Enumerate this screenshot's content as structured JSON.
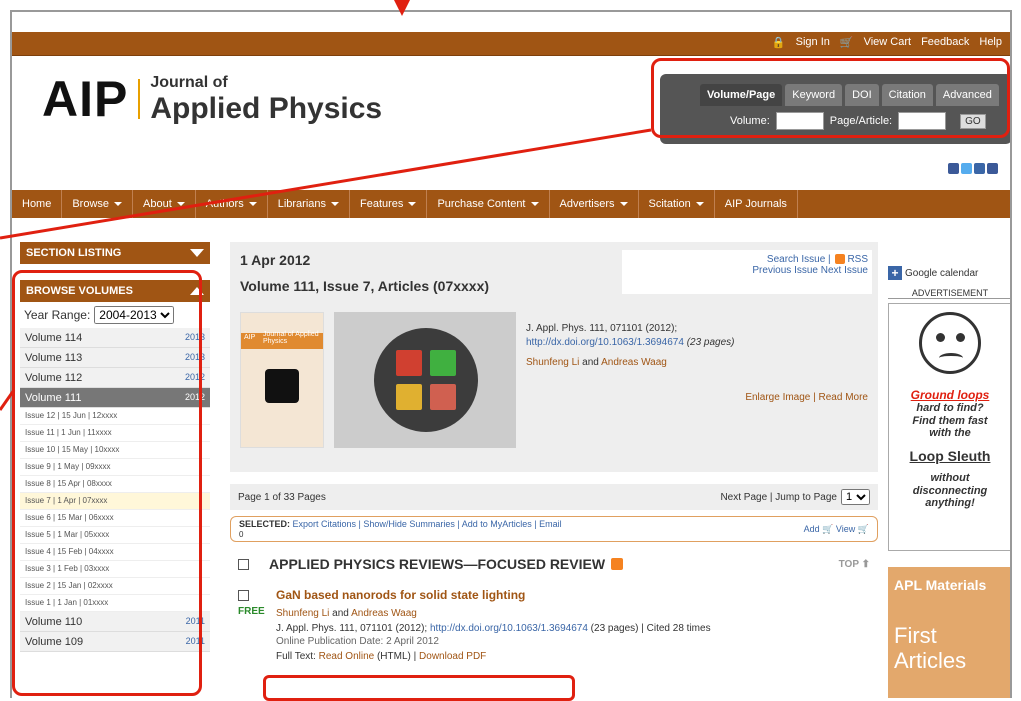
{
  "toplinks": {
    "signin": "Sign In",
    "cart": "View Cart",
    "feedback": "Feedback",
    "help": "Help"
  },
  "logo": {
    "aip": "AIP",
    "journal_of": "Journal of",
    "applied_physics": "Applied Physics"
  },
  "search": {
    "tabs": [
      "Volume/Page",
      "Keyword",
      "DOI",
      "Citation",
      "Advanced"
    ],
    "volume_label": "Volume:",
    "page_label": "Page/Article:",
    "go": "GO"
  },
  "nav": [
    {
      "label": "Home",
      "caret": false
    },
    {
      "label": "Browse",
      "caret": true
    },
    {
      "label": "About",
      "caret": true
    },
    {
      "label": "Authors",
      "caret": true
    },
    {
      "label": "Librarians",
      "caret": true
    },
    {
      "label": "Features",
      "caret": true
    },
    {
      "label": "Purchase Content",
      "caret": true
    },
    {
      "label": "Advertisers",
      "caret": true
    },
    {
      "label": "Scitation",
      "caret": true
    },
    {
      "label": "AIP Journals",
      "caret": false
    }
  ],
  "sidebar": {
    "section_listing": "SECTION LISTING",
    "browse_volumes": "BROWSE VOLUMES",
    "year_range_label": "Year Range:",
    "year_range_value": "2004-2013",
    "volumes_top": [
      {
        "name": "Volume 114",
        "year": "2013"
      },
      {
        "name": "Volume 113",
        "year": "2013"
      },
      {
        "name": "Volume 112",
        "year": "2012"
      },
      {
        "name": "Volume 111",
        "year": "2012"
      }
    ],
    "issues": [
      "Issue 12 | 15 Jun | 12xxxx",
      "Issue 11 | 1 Jun | 11xxxx",
      "Issue 10 | 15 May | 10xxxx",
      "Issue 9 | 1 May | 09xxxx",
      "Issue 8 | 15 Apr | 08xxxx",
      "Issue 7 | 1 Apr | 07xxxx",
      "Issue 6 | 15 Mar | 06xxxx",
      "Issue 5 | 1 Mar | 05xxxx",
      "Issue 4 | 15 Feb | 04xxxx",
      "Issue 3 | 1 Feb | 03xxxx",
      "Issue 2 | 15 Jan | 02xxxx",
      "Issue 1 | 1 Jan | 01xxxx"
    ],
    "volumes_bottom": [
      {
        "name": "Volume 110",
        "year": "2011"
      },
      {
        "name": "Volume 109",
        "year": "2011"
      }
    ]
  },
  "issue": {
    "date": "1 Apr 2012",
    "title": "Volume 111, Issue 7, Articles (07xxxx)",
    "search_issue": "Search Issue | ",
    "rss": "RSS",
    "prev_next": "Previous Issue Next Issue",
    "cover_title": "Journal of Applied Physics",
    "cover_logo": "AIP",
    "citation": "J. Appl. Phys. 111, 071101 (2012);",
    "doi": "http://dx.doi.org/10.1063/1.3694674",
    "pages": "(23 pages)",
    "authors_a": "Shunfeng Li",
    "and": " and ",
    "authors_b": "Andreas Waag",
    "enlarge": "Enlarge Image | Read More"
  },
  "pager": {
    "text": "Page 1 of 33 Pages",
    "next": "Next Page | Jump to Page",
    "page": "1"
  },
  "selected": {
    "label": "SELECTED:",
    "links": "Export Citations | Show/Hide Summaries | Add to MyArticles | Email",
    "count": "0",
    "add": "Add",
    "view": "View"
  },
  "section": {
    "title": "APPLIED PHYSICS REVIEWS—FOCUSED REVIEW",
    "top": "TOP"
  },
  "article": {
    "title": "GaN based nanorods for solid state lighting",
    "free": "FREE",
    "auth_a": "Shunfeng Li",
    "and": " and ",
    "auth_b": "Andreas Waag",
    "cite": "J. Appl. Phys. 111, 071101 (2012); ",
    "doi": "http://dx.doi.org/10.1063/1.3694674",
    "cite_tail": " (23 pages) | Cited 28 times",
    "pub": "Online Publication Date: 2 April 2012",
    "full_label": "Full Text: ",
    "read_online": "Read Online",
    "html": " (HTML) | ",
    "pdf": "Download PDF"
  },
  "right": {
    "gcal": "Google calendar",
    "advertisement": "ADVERTISEMENT",
    "ad1": {
      "h": "Ground loops",
      "l1": "hard to find?",
      "l2": "Find them fast",
      "l3": "with the",
      "brand": "Loop Sleuth",
      "l4": "without",
      "l5": "disconnecting",
      "l6": "anything!"
    },
    "ad2": {
      "h": "APL Materials",
      "b": "First Articles"
    }
  },
  "colors": {
    "brand_brown": "#a05514",
    "highlight_red": "#e02010",
    "link_blue": "#3a66a7"
  }
}
